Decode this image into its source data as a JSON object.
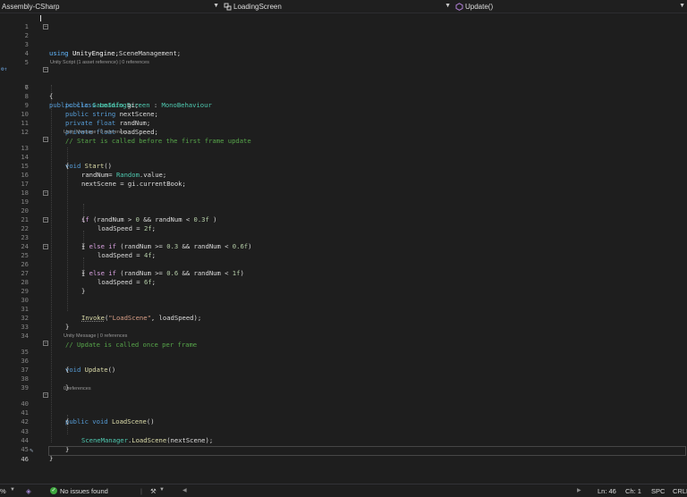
{
  "navbar": {
    "project": "Assembly-CSharp",
    "class_name": "LoadingScreen",
    "member": "Update()"
  },
  "editor": {
    "current_line": "46",
    "line_numbers": [
      "1",
      "2",
      "3",
      "4",
      "5",
      "6",
      "7",
      "8",
      "9",
      "10",
      "11",
      "12",
      "13",
      "14",
      "15",
      "16",
      "17",
      "18",
      "19",
      "20",
      "21",
      "22",
      "23",
      "24",
      "25",
      "26",
      "27",
      "28",
      "29",
      "30",
      "31",
      "32",
      "33",
      "34",
      "35",
      "36",
      "37",
      "38",
      "39",
      "40",
      "41",
      "42",
      "43",
      "44",
      "45",
      "46"
    ],
    "code_lens": {
      "class": "Unity Script (1 asset reference) | 0 references",
      "start": "Unity Message | 0 references",
      "update": "Unity Message | 0 references",
      "loadscene": "0 references"
    },
    "lines": {
      "l2": [
        "using",
        " UnityEngine;"
      ],
      "l3": [
        "using",
        " UnityEngine.SceneManagement;"
      ],
      "l6": [
        "public",
        " ",
        "class",
        " ",
        "LoadingScreen",
        " : ",
        "MonoBehaviour"
      ],
      "l7": [
        "{"
      ],
      "l8": [
        "public",
        " ",
        "GameInfo",
        " gi;"
      ],
      "l9": [
        "public",
        " ",
        "string",
        " nextScene;"
      ],
      "l10": [
        "private",
        " ",
        "float",
        " randNum;"
      ],
      "l11": [
        "private",
        " ",
        "float",
        " loadSpeed;"
      ],
      "l12": [
        "// Start is called before the first frame update"
      ],
      "l13": [
        "void",
        " ",
        "Start",
        "()"
      ],
      "l14": [
        "{"
      ],
      "l15": [
        "randNum= ",
        "Random",
        ".value;"
      ],
      "l16": [
        "nextScene = gi.currentBook;"
      ],
      "l19": [
        "if",
        " (randNum > ",
        "0",
        " && randNum < ",
        "0.3f",
        " )"
      ],
      "l20": [
        "{"
      ],
      "l21": [
        "loadSpeed = ",
        "2f",
        ";"
      ],
      "l22": [
        "} ",
        "else",
        " ",
        "if",
        " (randNum >= ",
        "0.3",
        " && randNum < ",
        "0.6f",
        ")"
      ],
      "l23": [
        "{"
      ],
      "l24": [
        "loadSpeed = ",
        "4f",
        ";"
      ],
      "l25": [
        "} ",
        "else",
        " ",
        "if",
        " (randNum >= ",
        "0.6",
        " && randNum < ",
        "1f",
        ")"
      ],
      "l26": [
        "{"
      ],
      "l27": [
        "loadSpeed = ",
        "6f",
        ";"
      ],
      "l28": [
        "}"
      ],
      "l31": [
        "Invoke",
        "(",
        "\"LoadScene\"",
        ", loadSpeed);"
      ],
      "l32": [
        "}"
      ],
      "l34": [
        "// Update is called once per frame"
      ],
      "l35": [
        "void",
        " ",
        "Update",
        "()"
      ],
      "l36": [
        "{"
      ],
      "l38": [
        "}"
      ],
      "l40": [
        "public",
        " ",
        "void",
        " ",
        "LoadScene",
        "()"
      ],
      "l41": [
        "{"
      ],
      "l43": [
        "SceneManager",
        ".",
        "LoadScene",
        "(nextScene);"
      ],
      "l44": [
        "}"
      ],
      "l45": [
        "}"
      ]
    }
  },
  "status": {
    "zoom": "%",
    "issues": "No issues found",
    "line": "Ln: 46",
    "col": "Ch: 1",
    "indent": "SPC",
    "eol": "CRLF"
  },
  "colors": {
    "keyword": "#569cd6",
    "type": "#4ec9b0",
    "method": "#dcdcaa",
    "comment": "#57a64a",
    "string": "#d69d85",
    "number": "#b5cea8",
    "control": "#d8a0df"
  }
}
